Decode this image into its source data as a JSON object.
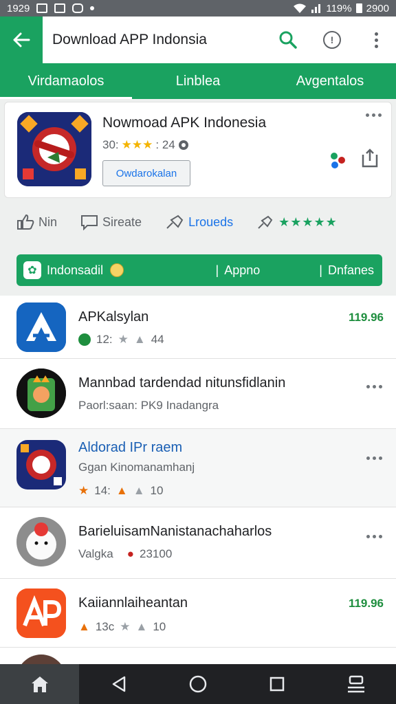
{
  "status_bar": {
    "time": "1929",
    "battery": "119%",
    "clock": "2900"
  },
  "app_bar": {
    "title": "Download APP Indonsia",
    "icons": [
      "back-arrow-icon",
      "search-icon",
      "info-icon",
      "more-vert-icon"
    ]
  },
  "tabs": [
    {
      "label": "Virdamaolos",
      "active": true
    },
    {
      "label": "Linblea",
      "active": false
    },
    {
      "label": "Avgentalos",
      "active": false
    }
  ],
  "featured": {
    "name": "Nowmoad APK Indonesia",
    "rating_prefix": "30:",
    "stars": "★★★",
    "rating_count": ": 24",
    "button_label": "Owdarokalan"
  },
  "actions": [
    {
      "label": "Nin",
      "icon": "thumb-up-icon"
    },
    {
      "label": "Sireate",
      "icon": "message-icon"
    },
    {
      "label": "Lroueds",
      "icon": "pin-icon"
    }
  ],
  "actions_stars": "★★★★★",
  "filter": {
    "label": "Indonsadil",
    "items": [
      "Appno",
      "Dnfanes"
    ]
  },
  "apps": [
    {
      "title": "APKalsylan",
      "rating": "12:",
      "votes": "44",
      "price": "119.96"
    },
    {
      "title": "Mannbad tardendad nitunsfidlanin",
      "subtitle": "Paorl:saan: PK9 Inadangra"
    },
    {
      "title": "Aldorad IPr raem",
      "subtitle": "Ggan Kinomanamhanj",
      "rating": "14:",
      "votes": "10"
    },
    {
      "title": "BarieluisamNanistanachaharlos",
      "subtitle": "Valgka",
      "meta": "23100"
    },
    {
      "title": "Kaiiannlaiheantan",
      "rating": "13c",
      "votes": "10",
      "price": "119.96"
    }
  ],
  "colors": {
    "accent": "#1aa260",
    "price": "#1e8e3e",
    "link": "#1a73e8"
  }
}
